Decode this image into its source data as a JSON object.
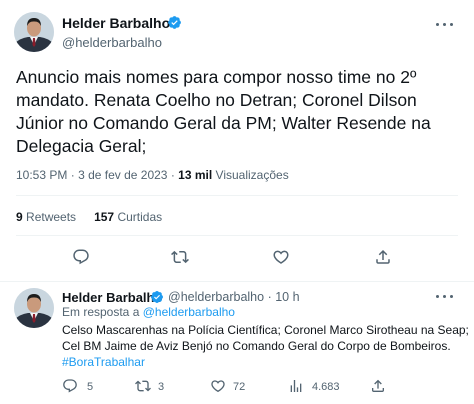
{
  "main_tweet": {
    "author_name": "Helder Barbalho",
    "author_handle": "@helderbarbalho",
    "verified_badge_color": "#1d9bf0",
    "text_lines": [
      "Anuncio mais nomes para compor nosso time no 2º",
      "mandato. Renata Coelho no Detran; Coronel Dilson",
      "Júnior no Comando Geral da PM; Walter Resende na",
      "Delegacia Geral;"
    ],
    "time": "10:53 PM",
    "date": "3 de fev de 2023",
    "separator": "·",
    "views_count": "13 mil",
    "views_label": "Visualizações",
    "retweets_count": "9",
    "retweets_label": "Retweets",
    "likes_count": "157",
    "likes_label": "Curtidas",
    "actions": [
      "reply-icon",
      "retweet-icon",
      "like-icon",
      "share-icon"
    ]
  },
  "reply_tweet": {
    "author_name": "Helder Barbalho",
    "author_handle": "@helderbarbalho",
    "time_ago": "· 10 h",
    "reply_to_label": "Em resposta a",
    "reply_to_handle": "@helderbarbalho",
    "text_lines": [
      "Celso Mascarenhas na Polícia Científica; Coronel Marco Sirotheau na Seap;",
      "Cel BM Jaime de Aviz Benjó no Comando Geral do Corpo de Bombeiros."
    ],
    "hashtag": "#BoraTrabalhar",
    "replies_count": "5",
    "retweets_count": "3",
    "likes_count": "72",
    "views_count": "4.683",
    "actions": [
      "reply-icon",
      "retweet-icon",
      "like-icon",
      "views-icon",
      "share-icon"
    ]
  },
  "colors": {
    "text_primary": "#0f1419",
    "text_secondary": "#536471",
    "accent": "#1d9bf0",
    "divider": "#eff3f4"
  }
}
